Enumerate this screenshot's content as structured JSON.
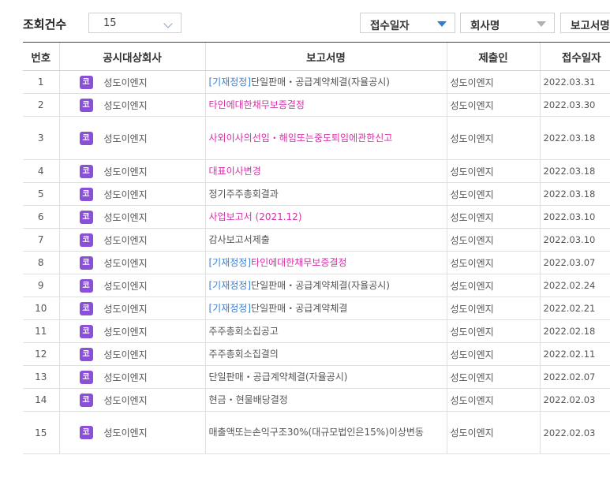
{
  "toolbar": {
    "count_label": "조회건수",
    "count_value": "15",
    "sort_buttons": [
      "접수일자",
      "회사명",
      "보고서명"
    ]
  },
  "colors": {
    "accent": "#2a7ad8",
    "badge": "#8a50d8",
    "link_magenta": "#d630a8",
    "link_blue": "#3a7fd5"
  },
  "table": {
    "headers": [
      "번호",
      "공시대상회사",
      "보고서명",
      "제출인",
      "접수일자"
    ],
    "badge_label": "코",
    "rows": [
      {
        "no": "1",
        "company": "성도이엔지",
        "prefix": "[기재정정]",
        "title": "단일판매・공급계약체결(자율공시)",
        "title_color": "grey",
        "submitter": "성도이엔지",
        "date": "2022.03.31"
      },
      {
        "no": "2",
        "company": "성도이엔지",
        "prefix": "",
        "title": "타인에대한채무보증결정",
        "title_color": "magenta",
        "submitter": "성도이엔지",
        "date": "2022.03.30"
      },
      {
        "no": "3",
        "company": "성도이엔지",
        "prefix": "",
        "title": "사외이사의선임・해임또는중도퇴임에관한신고",
        "title_color": "magenta",
        "submitter": "성도이엔지",
        "date": "2022.03.18"
      },
      {
        "no": "4",
        "company": "성도이엔지",
        "prefix": "",
        "title": "대표이사변경",
        "title_color": "magenta",
        "submitter": "성도이엔지",
        "date": "2022.03.18"
      },
      {
        "no": "5",
        "company": "성도이엔지",
        "prefix": "",
        "title": "정기주주총회결과",
        "title_color": "grey",
        "submitter": "성도이엔지",
        "date": "2022.03.18"
      },
      {
        "no": "6",
        "company": "성도이엔지",
        "prefix": "",
        "title": "사업보고서 (2021.12)",
        "title_color": "magenta",
        "submitter": "성도이엔지",
        "date": "2022.03.10"
      },
      {
        "no": "7",
        "company": "성도이엔지",
        "prefix": "",
        "title": "감사보고서제출",
        "title_color": "grey",
        "submitter": "성도이엔지",
        "date": "2022.03.10"
      },
      {
        "no": "8",
        "company": "성도이엔지",
        "prefix": "[기재정정]",
        "title": "타인에대한채무보증결정",
        "title_color": "magenta",
        "submitter": "성도이엔지",
        "date": "2022.03.07"
      },
      {
        "no": "9",
        "company": "성도이엔지",
        "prefix": "[기재정정]",
        "title": "단일판매・공급계약체결(자율공시)",
        "title_color": "grey",
        "submitter": "성도이엔지",
        "date": "2022.02.24"
      },
      {
        "no": "10",
        "company": "성도이엔지",
        "prefix": "[기재정정]",
        "title": "단일판매・공급계약체결",
        "title_color": "grey",
        "submitter": "성도이엔지",
        "date": "2022.02.21"
      },
      {
        "no": "11",
        "company": "성도이엔지",
        "prefix": "",
        "title": "주주총회소집공고",
        "title_color": "grey",
        "submitter": "성도이엔지",
        "date": "2022.02.18"
      },
      {
        "no": "12",
        "company": "성도이엔지",
        "prefix": "",
        "title": "주주총회소집결의",
        "title_color": "grey",
        "submitter": "성도이엔지",
        "date": "2022.02.11"
      },
      {
        "no": "13",
        "company": "성도이엔지",
        "prefix": "",
        "title": "단일판매・공급계약체결(자율공시)",
        "title_color": "grey",
        "submitter": "성도이엔지",
        "date": "2022.02.07"
      },
      {
        "no": "14",
        "company": "성도이엔지",
        "prefix": "",
        "title": "현금・현물배당결정",
        "title_color": "grey",
        "submitter": "성도이엔지",
        "date": "2022.02.03"
      },
      {
        "no": "15",
        "company": "성도이엔지",
        "prefix": "",
        "title": "매출액또는손익구조30%(대규모법인은15%)이상변동",
        "title_color": "grey",
        "submitter": "성도이엔지",
        "date": "2022.02.03"
      }
    ]
  }
}
